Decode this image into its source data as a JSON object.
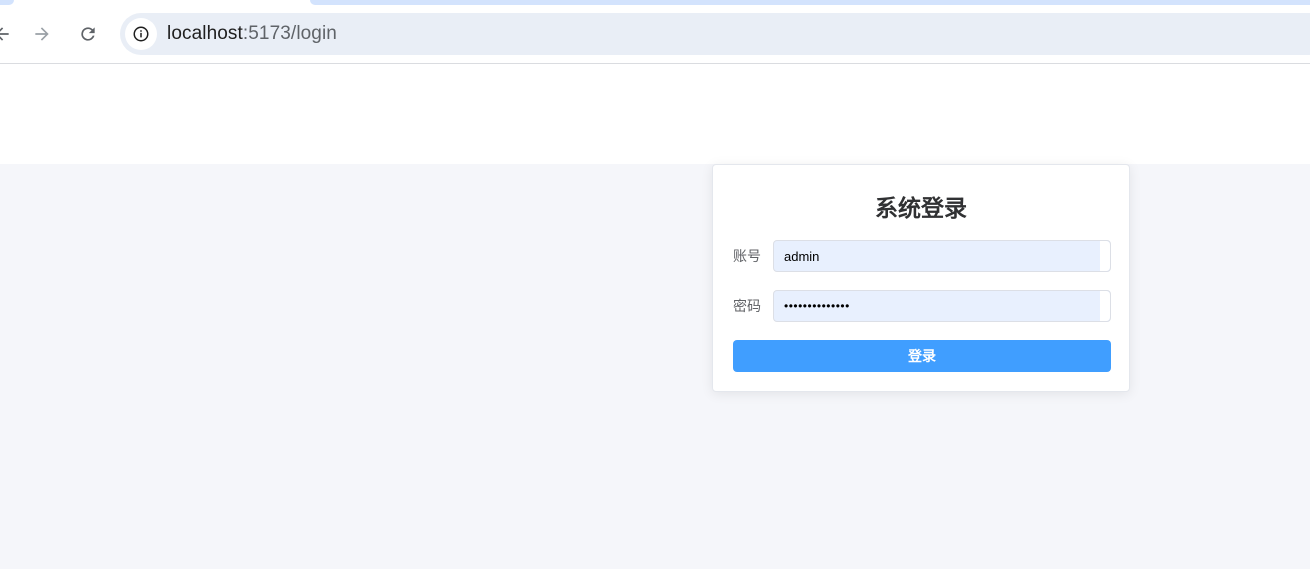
{
  "browser": {
    "url_host": "localhost",
    "url_path": ":5173/login"
  },
  "login": {
    "title": "系统登录",
    "account_label": "账号",
    "account_value": "admin",
    "password_label": "密码",
    "password_value": "••••••••••••••",
    "submit_label": "登录"
  },
  "colors": {
    "primary": "#409eff",
    "page_background": "#f5f6fa",
    "autofill_background": "#e8f0fe"
  }
}
